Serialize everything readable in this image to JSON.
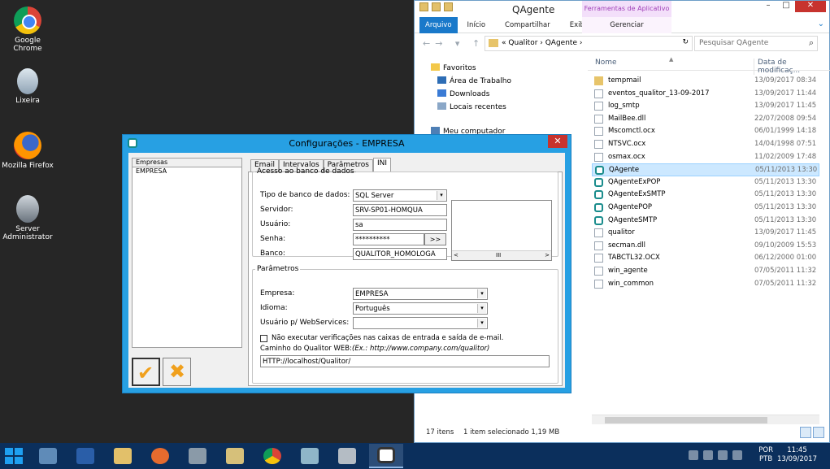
{
  "desktop_icons": [
    {
      "label": "Google Chrome",
      "icon": "chrome-icon"
    },
    {
      "label": "Lixeira",
      "icon": "recycle-bin-icon"
    },
    {
      "label": "Mozilla Firefox",
      "icon": "firefox-icon"
    },
    {
      "label": "Server Administrator",
      "icon": "server-admin-icon"
    }
  ],
  "explorer": {
    "title": "QAgente",
    "context_tab_header": "Ferramentas de Aplicativo",
    "window_buttons": {
      "min": "–",
      "max": "□",
      "close": "✕"
    },
    "ribbon": {
      "file": "Arquivo",
      "home": "Início",
      "share": "Compartilhar",
      "view": "Exibir",
      "manage": "Gerenciar",
      "chevron": "⌄"
    },
    "nav_arrows": "←→ ▾ ↑",
    "address": {
      "path": "«  Qualitor  ›  QAgente  ›",
      "refresh": "↻"
    },
    "search": {
      "placeholder": "Pesquisar QAgente",
      "icon": "⌕"
    },
    "nav_pane": {
      "favorites": "Favoritos",
      "items": [
        "Área de Trabalho",
        "Downloads",
        "Locais recentes"
      ],
      "computer": "Meu computador"
    },
    "columns": {
      "name": "Nome",
      "date": "Data de modificaç...",
      "sort": "▲"
    },
    "files": [
      {
        "name": "tempmail",
        "date": "13/09/2017 08:34",
        "type": "folder"
      },
      {
        "name": "eventos_qualitor_13-09-2017",
        "date": "13/09/2017 11:44",
        "type": "doc"
      },
      {
        "name": "log_smtp",
        "date": "13/09/2017 11:45",
        "type": "doc"
      },
      {
        "name": "MailBee.dll",
        "date": "22/07/2008 09:54",
        "type": "doc"
      },
      {
        "name": "Mscomctl.ocx",
        "date": "06/01/1999 14:18",
        "type": "doc"
      },
      {
        "name": "NTSVC.ocx",
        "date": "14/04/1998 07:51",
        "type": "doc"
      },
      {
        "name": "osmax.ocx",
        "date": "11/02/2009 17:48",
        "type": "doc"
      },
      {
        "name": "QAgente",
        "date": "05/11/2013 13:30",
        "type": "qa",
        "selected": true
      },
      {
        "name": "QAgenteExPOP",
        "date": "05/11/2013 13:30",
        "type": "qa"
      },
      {
        "name": "QAgenteExSMTP",
        "date": "05/11/2013 13:30",
        "type": "qa"
      },
      {
        "name": "QAgentePOP",
        "date": "05/11/2013 13:30",
        "type": "qa"
      },
      {
        "name": "QAgenteSMTP",
        "date": "05/11/2013 13:30",
        "type": "qa"
      },
      {
        "name": "qualitor",
        "date": "13/09/2017 11:45",
        "type": "doc"
      },
      {
        "name": "secman.dll",
        "date": "09/10/2009 15:53",
        "type": "doc"
      },
      {
        "name": "TABCTL32.OCX",
        "date": "06/12/2000 01:00",
        "type": "doc"
      },
      {
        "name": "win_agente",
        "date": "07/05/2011 11:32",
        "type": "doc"
      },
      {
        "name": "win_common",
        "date": "07/05/2011 11:32",
        "type": "doc"
      }
    ],
    "status": {
      "count": "17 itens",
      "selection": "1 item selecionado  1,19 MB"
    }
  },
  "dialog": {
    "title": "Configurações - EMPRESA",
    "close": "✕",
    "left_header": "Empresas",
    "left_items": [
      "EMPRESA"
    ],
    "ok_icon": "✔",
    "cancel_icon": "✖",
    "tabs": [
      "Email",
      "Intervalos",
      "Parâmetros",
      "INI"
    ],
    "active_tab": "INI",
    "db_group": {
      "legend": "Acesso ao banco de dados",
      "db_type_label": "Tipo de banco de dados:",
      "db_type_value": "SQL Server",
      "server_label": "Servidor:",
      "server_value": "SRV-SP01-HOMQUA",
      "user_label": "Usuário:",
      "user_value": "sa",
      "password_label": "Senha:",
      "password_value": "**********",
      "browse_label": ">>",
      "db_label": "Banco:",
      "db_value": "QUALITOR_HOMOLOGA",
      "scroll_left": "<",
      "scroll_thumb": "III",
      "scroll_right": ">"
    },
    "params_group": {
      "legend": "Parâmetros",
      "company_label": "Empresa:",
      "company_value": "EMPRESA",
      "language_label": "Idioma:",
      "language_value": "Português",
      "ws_user_label": "Usuário p/ WebServices:",
      "ws_user_value": "",
      "skip_checks_label": "Não executar verificações nas caixas de entrada e saída de e-mail.",
      "skip_checks_checked": false,
      "web_path_label": "Caminho do Qualitor WEB:",
      "web_path_hint": "(Ex.: http://www.company.com/qualitor)",
      "web_path_value": "HTTP://localhost/Qualitor/"
    },
    "dropdown_arrow": "▾"
  },
  "taskbar": {
    "apps": [
      "server-manager-icon",
      "powershell-icon",
      "file-explorer-icon",
      "firefox-icon",
      "app-icon",
      "tools-icon",
      "chrome-icon",
      "app2-icon",
      "app3-icon",
      "qualitor-icon"
    ],
    "language": "POR",
    "layout": "PTB",
    "time": "11:45",
    "date": "13/09/2017"
  }
}
